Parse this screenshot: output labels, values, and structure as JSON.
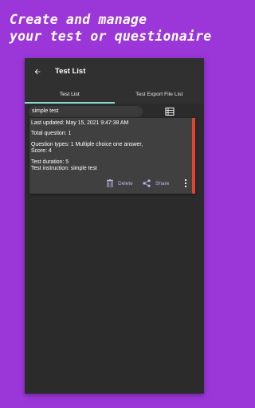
{
  "promo": {
    "line1": "Create and manage",
    "line2": "your test or questionaire"
  },
  "appbar": {
    "back_icon": "arrow-left-icon",
    "title": "Test List"
  },
  "tabs": [
    {
      "label": "Test List",
      "active": true
    },
    {
      "label": "Test Export File List",
      "active": false
    }
  ],
  "search": {
    "chip_text": "simple test",
    "list_icon": "list-view-icon"
  },
  "card": {
    "accent_color": "#e0442e",
    "last_updated": "Last updated: May 15, 2021 9:47:38 AM",
    "total_question": "Total question: 1",
    "question_types_line1": "Question types: 1 Multiple choice one answer,",
    "question_types_line2": "Score: 4",
    "test_duration": "Test duration: 5",
    "test_instruction": "Test instruction: simple test",
    "actions": {
      "delete_label": "Delete",
      "share_label": "Share",
      "more_icon": "more-vert-icon"
    }
  },
  "colors": {
    "background": "#9b36d9",
    "tab_indicator": "#8ad9d0",
    "action_text": "#b9b5e6"
  }
}
